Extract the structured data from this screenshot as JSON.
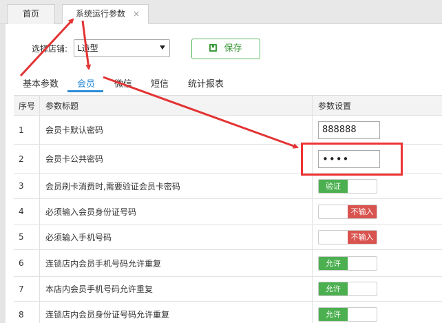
{
  "tabs": [
    {
      "label": "首页"
    },
    {
      "label": "系统运行参数",
      "close": "×"
    }
  ],
  "toolbar": {
    "store_label": "选择店铺:",
    "store_value": "L造型",
    "save_label": "保存"
  },
  "subtabs": [
    "基本参数",
    "会员",
    "微信",
    "短信",
    "统计报表"
  ],
  "active_subtab": "会员",
  "table": {
    "columns": [
      "序号",
      "参数标题",
      "参数设置"
    ],
    "rows": [
      {
        "no": "1",
        "title": "会员卡默认密码",
        "type": "input",
        "value": "888888"
      },
      {
        "no": "2",
        "title": "会员卡公共密码",
        "type": "password",
        "value": "••••"
      },
      {
        "no": "3",
        "title": "会员刷卡消费时,需要验证会员卡密码",
        "type": "toggle-on",
        "value": "验证"
      },
      {
        "no": "4",
        "title": "必须输入会员身份证号码",
        "type": "toggle-off",
        "value": "不输入"
      },
      {
        "no": "5",
        "title": "必须输入手机号码",
        "type": "toggle-off",
        "value": "不输入"
      },
      {
        "no": "6",
        "title": "连锁店内会员手机号码允许重复",
        "type": "toggle-on",
        "value": "允许"
      },
      {
        "no": "7",
        "title": "本店内会员手机号码允许重复",
        "type": "toggle-on",
        "value": "允许"
      },
      {
        "no": "8",
        "title": "连锁店内会员身份证号码允许重复",
        "type": "toggle-on",
        "value": "允许"
      }
    ]
  },
  "colors": {
    "accent": "#2b8bd5",
    "toggle_on": "#4caf50",
    "toggle_off": "#d9534f",
    "annotation": "#e33333"
  },
  "icons": [
    "close-icon",
    "dropdown-caret-icon",
    "save-disk-icon"
  ]
}
